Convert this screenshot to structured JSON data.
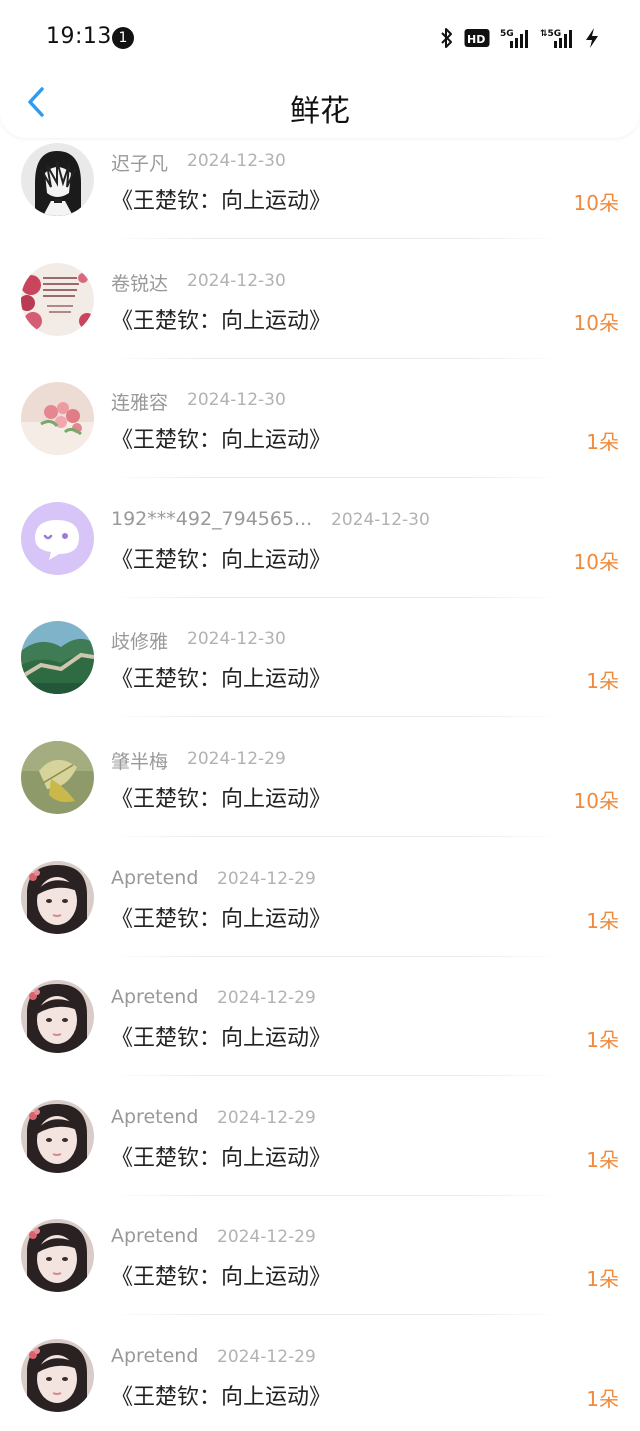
{
  "status_bar": {
    "time": "19:13",
    "notification_count": "1",
    "icons": [
      "bluetooth-icon",
      "hd-icon",
      "signal-5g-icon",
      "signal-5g-icon",
      "charging-icon"
    ]
  },
  "header": {
    "title": "鲜花",
    "back_icon": "chevron-left-icon"
  },
  "colors": {
    "accent_blue": "#2f9bf0",
    "count_orange": "#f08a3c",
    "name_gray": "#999999",
    "date_gray": "#b2b2b2"
  },
  "rows": [
    {
      "name": "迟子凡",
      "date": "2024-12-30",
      "title": "《王楚钦：向上运动》",
      "count": "10朵",
      "avatar": "anime-avatar"
    },
    {
      "name": "卷锐达",
      "date": "2024-12-30",
      "title": "《王楚钦：向上运动》",
      "count": "10朵",
      "avatar": "floral-text-avatar"
    },
    {
      "name": "连雅容",
      "date": "2024-12-30",
      "title": "《王楚钦：向上运动》",
      "count": "1朵",
      "avatar": "flower-avatar"
    },
    {
      "name": "192***492_794565...",
      "date": "2024-12-30",
      "title": "《王楚钦：向上运动》",
      "count": "10朵",
      "avatar": "default-chat-avatar"
    },
    {
      "name": "歧修雅",
      "date": "2024-12-30",
      "title": "《王楚钦：向上运动》",
      "count": "1朵",
      "avatar": "great-wall-avatar"
    },
    {
      "name": "肇半梅",
      "date": "2024-12-29",
      "title": "《王楚钦：向上运动》",
      "count": "10朵",
      "avatar": "leaf-avatar"
    },
    {
      "name": "Apretend",
      "date": "2024-12-29",
      "title": "《王楚钦：向上运动》",
      "count": "1朵",
      "avatar": "girl-avatar"
    },
    {
      "name": "Apretend",
      "date": "2024-12-29",
      "title": "《王楚钦：向上运动》",
      "count": "1朵",
      "avatar": "girl-avatar"
    },
    {
      "name": "Apretend",
      "date": "2024-12-29",
      "title": "《王楚钦：向上运动》",
      "count": "1朵",
      "avatar": "girl-avatar"
    },
    {
      "name": "Apretend",
      "date": "2024-12-29",
      "title": "《王楚钦：向上运动》",
      "count": "1朵",
      "avatar": "girl-avatar"
    },
    {
      "name": "Apretend",
      "date": "2024-12-29",
      "title": "《王楚钦：向上运动》",
      "count": "1朵",
      "avatar": "girl-avatar"
    }
  ]
}
